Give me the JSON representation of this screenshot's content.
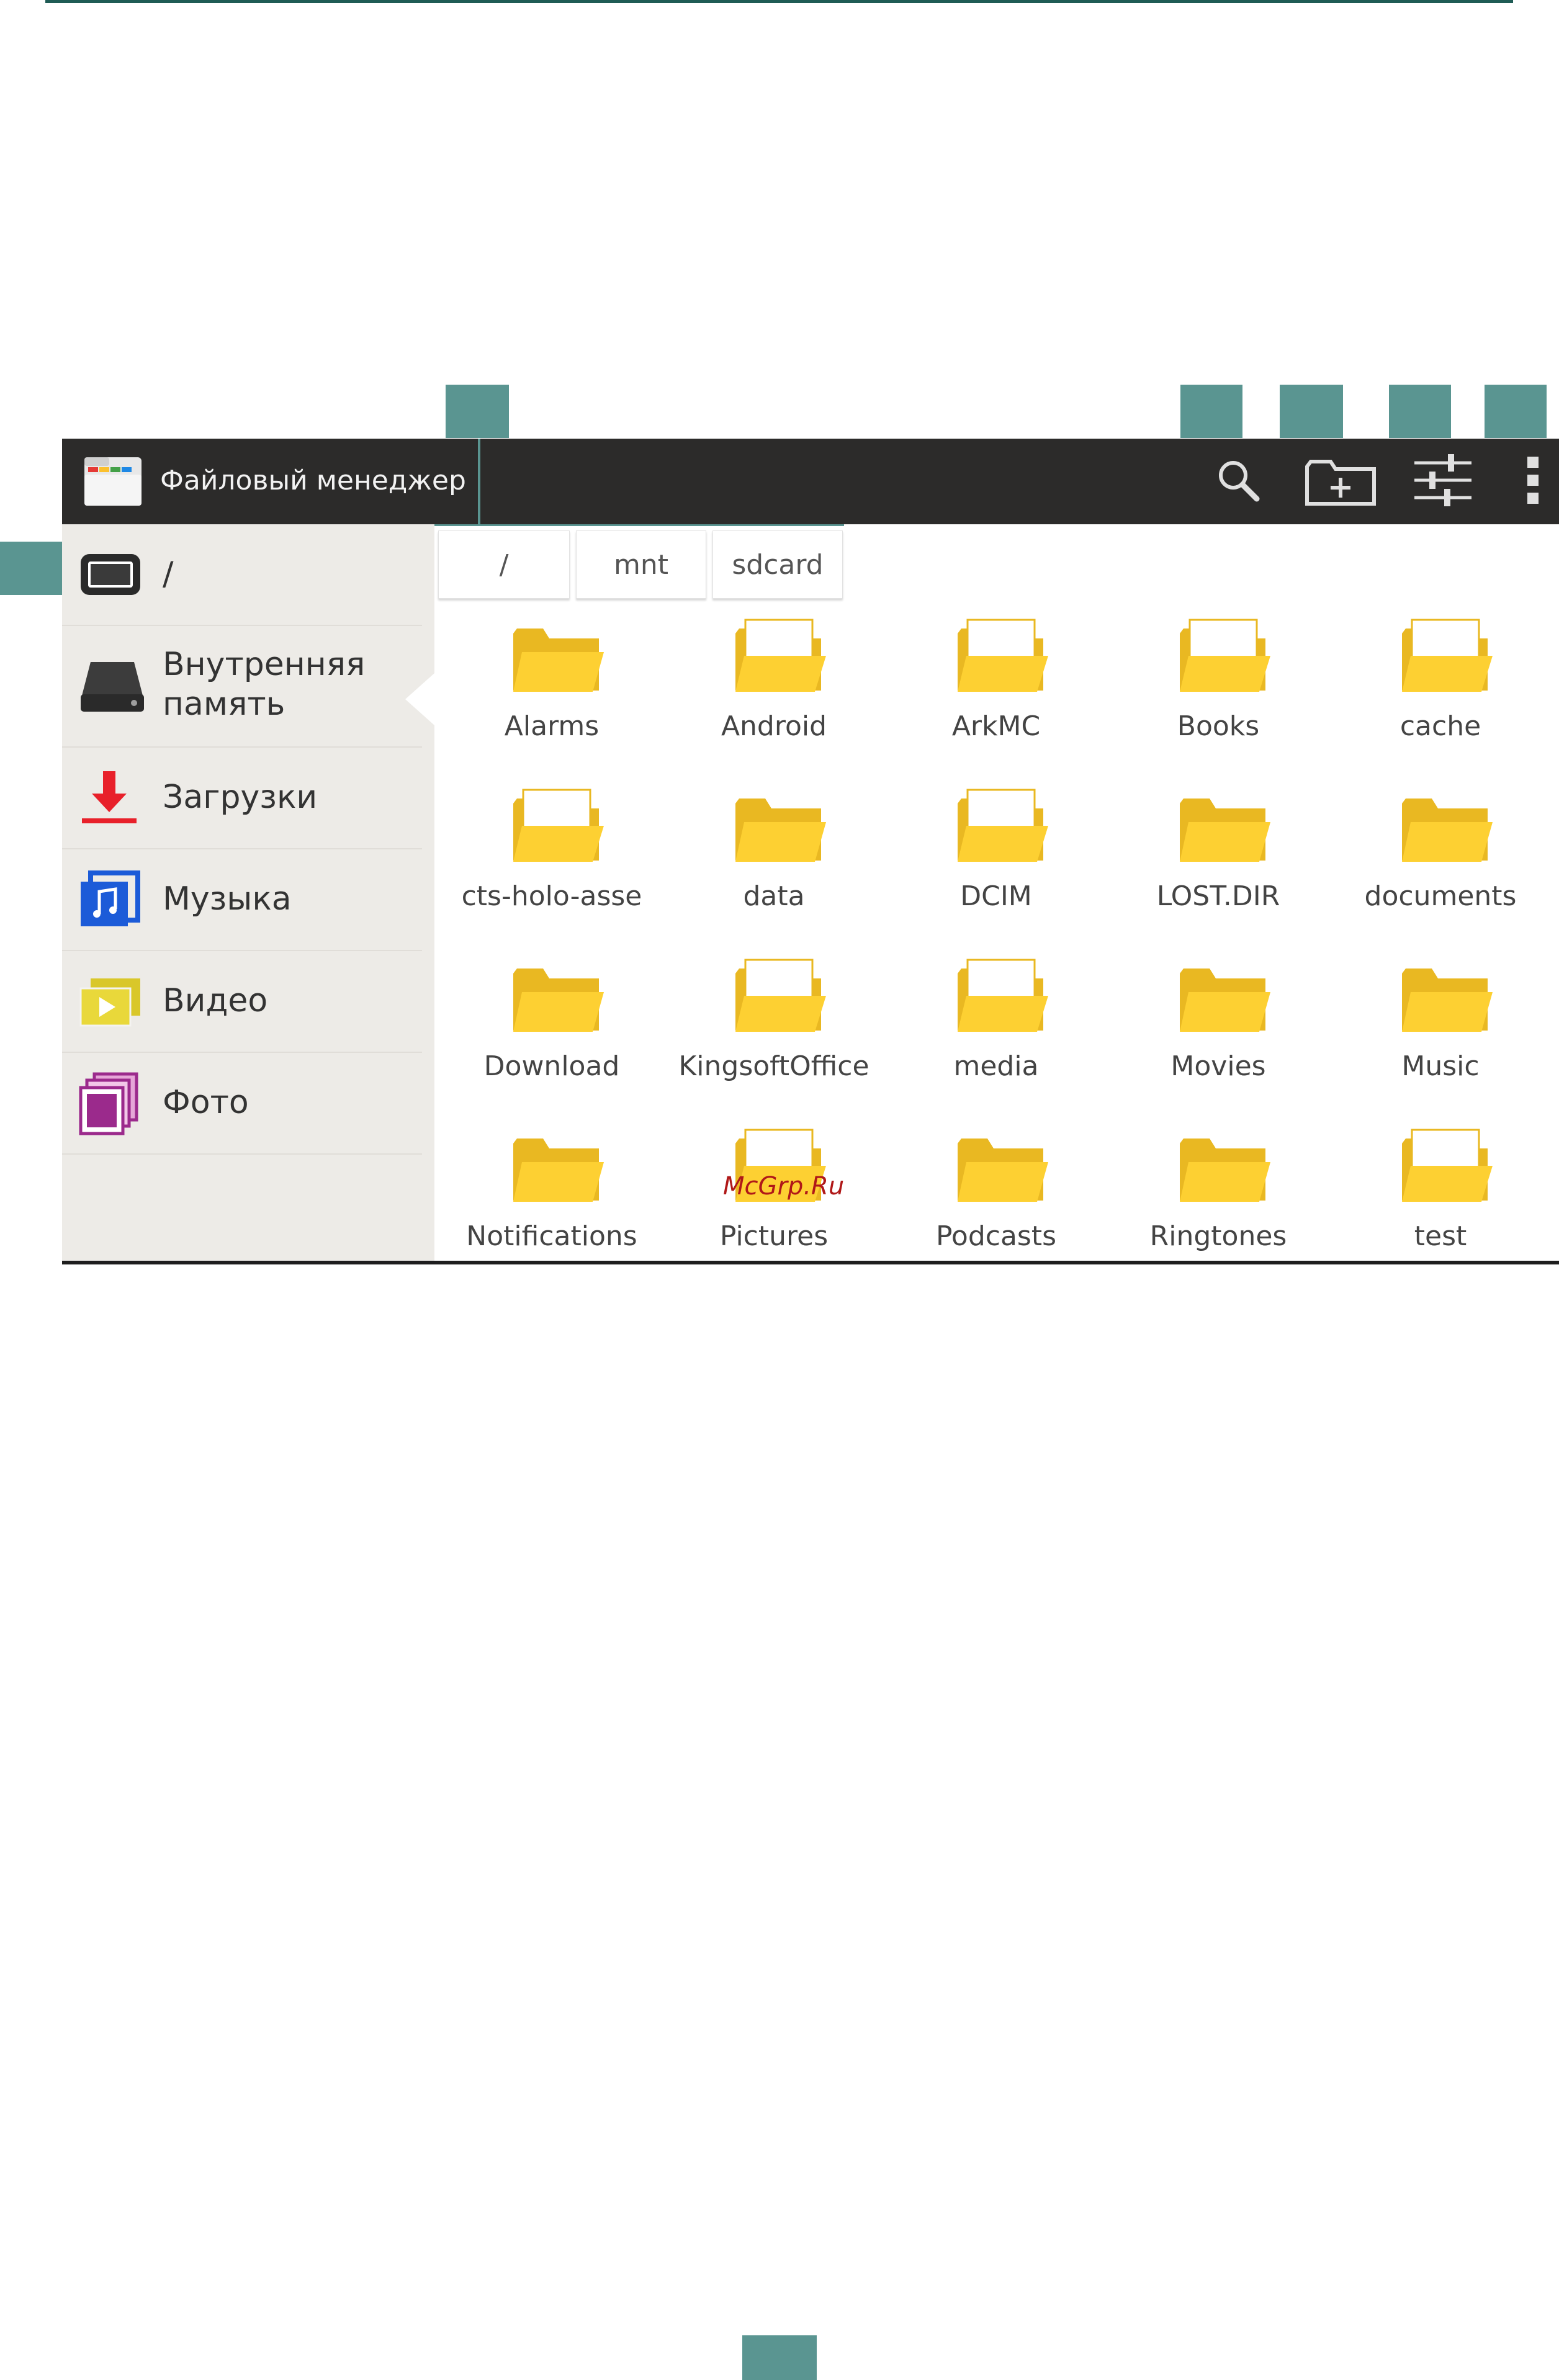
{
  "app": {
    "title": "Файловый менеджер"
  },
  "actions": [
    {
      "name": "search-button",
      "icon": "search-icon"
    },
    {
      "name": "new-folder-button",
      "icon": "folder-add-icon"
    },
    {
      "name": "settings-button",
      "icon": "sliders-icon"
    },
    {
      "name": "overflow-menu-button",
      "icon": "more-vertical-icon"
    }
  ],
  "sidebar": {
    "items": [
      {
        "label": "/",
        "icon": "tablet-icon"
      },
      {
        "label": "Внутренняя память",
        "icon": "hard-drive-icon"
      },
      {
        "label": "Загрузки",
        "icon": "download-icon"
      },
      {
        "label": "Музыка",
        "icon": "music-icon"
      },
      {
        "label": "Видео",
        "icon": "video-icon"
      },
      {
        "label": "Фото",
        "icon": "photo-icon"
      }
    ]
  },
  "breadcrumb": [
    "/",
    "mnt",
    "sdcard"
  ],
  "folders": [
    {
      "name": "Alarms",
      "icon": "folder-icon"
    },
    {
      "name": "Android",
      "icon": "folder-with-file-icon"
    },
    {
      "name": "ArkMC",
      "icon": "folder-with-file-icon"
    },
    {
      "name": "Books",
      "icon": "folder-with-file-icon"
    },
    {
      "name": "cache",
      "icon": "folder-with-file-icon"
    },
    {
      "name": "cts-holo-asse",
      "icon": "folder-with-file-icon"
    },
    {
      "name": "data",
      "icon": "folder-icon"
    },
    {
      "name": "DCIM",
      "icon": "folder-with-file-icon"
    },
    {
      "name": "LOST.DIR",
      "icon": "folder-icon"
    },
    {
      "name": "documents",
      "icon": "folder-icon"
    },
    {
      "name": "Download",
      "icon": "folder-icon"
    },
    {
      "name": "KingsoftOffice",
      "icon": "folder-with-file-icon"
    },
    {
      "name": "media",
      "icon": "folder-with-file-icon"
    },
    {
      "name": "Movies",
      "icon": "folder-icon"
    },
    {
      "name": "Music",
      "icon": "folder-icon"
    },
    {
      "name": "Notifications",
      "icon": "folder-icon"
    },
    {
      "name": "Pictures",
      "icon": "folder-with-file-icon"
    },
    {
      "name": "Podcasts",
      "icon": "folder-icon"
    },
    {
      "name": "Ringtones",
      "icon": "folder-icon"
    },
    {
      "name": "test",
      "icon": "folder-with-file-icon"
    }
  ],
  "watermark": "McGrp.Ru",
  "colors": {
    "actionbar": "#2c2b2a",
    "sidebar": "#edebe7",
    "folder": "#fdd032",
    "callout": "#5a9591",
    "rule": "#1f5c55"
  }
}
